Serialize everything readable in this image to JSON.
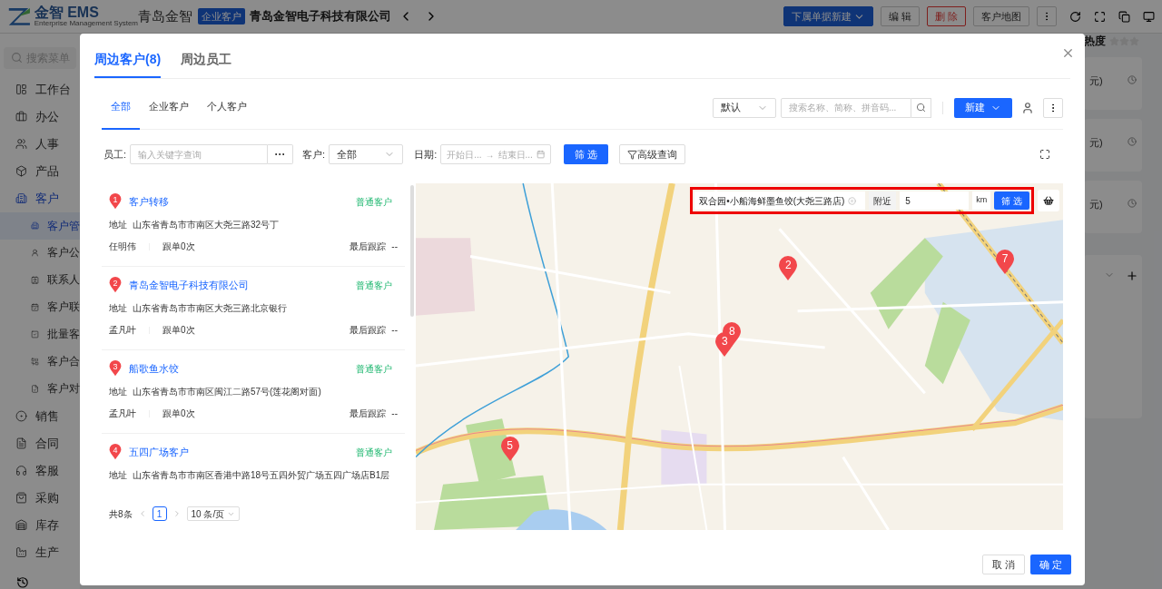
{
  "app": {
    "logo_text": "金智 EMS",
    "logo_subtitle": "Enterprise Management System",
    "company_cut": "青岛金智",
    "badge": "企业客户",
    "title": "青岛金智电子科技有限公司",
    "actions": [
      {
        "label": "下属单据新建",
        "kind": "primary"
      },
      {
        "label": "编 辑",
        "kind": "default"
      },
      {
        "label": "删 除",
        "kind": "danger"
      },
      {
        "label": "客户地图",
        "kind": "default"
      }
    ]
  },
  "sidebar": {
    "search_placeholder": "搜索菜单",
    "items": [
      {
        "label": "工作台",
        "selected": false
      },
      {
        "label": "办公",
        "selected": false
      },
      {
        "label": "人事",
        "selected": false
      },
      {
        "label": "产品",
        "selected": false
      },
      {
        "label": "客户",
        "selected": true,
        "children": [
          {
            "label": "客户管",
            "selected": true
          },
          {
            "label": "客户公",
            "selected": false
          },
          {
            "label": "联系人",
            "selected": false
          },
          {
            "label": "客户联",
            "selected": false
          },
          {
            "label": "批量客",
            "selected": false
          },
          {
            "label": "客户合",
            "selected": false
          },
          {
            "label": "客户对",
            "selected": false
          }
        ]
      },
      {
        "label": "销售",
        "selected": false
      },
      {
        "label": "合同",
        "selected": false
      },
      {
        "label": "客服",
        "selected": false
      },
      {
        "label": "采购",
        "selected": false
      },
      {
        "label": "库存",
        "selected": false
      },
      {
        "label": "生产",
        "selected": false
      }
    ]
  },
  "right_panel": {
    "heading": "热度",
    "amounts": [
      "元)",
      "元)",
      "元)"
    ]
  },
  "modal": {
    "tabs": [
      {
        "label": "周边客户(8)",
        "selected": true
      },
      {
        "label": "周边员工",
        "selected": false
      }
    ],
    "sub_tabs": [
      {
        "label": "全部",
        "selected": true
      },
      {
        "label": "企业客户",
        "selected": false
      },
      {
        "label": "个人客户",
        "selected": false
      }
    ],
    "sort_value": "默认",
    "search_placeholder": "搜索名称、简称、拼音码...",
    "new_button": "新建",
    "filters": {
      "employee_label": "员工:",
      "employee_placeholder": "输入关键字查询",
      "more": "···",
      "customer_label": "客户:",
      "customer_value": "全部",
      "date_label": "日期:",
      "date_start": "开始日...",
      "date_arrow": "→",
      "date_end": "结束日...",
      "filter_button": "筛 选",
      "advanced_button": "高级查询"
    },
    "customers": [
      {
        "index": "1",
        "name": "客户转移",
        "type": "普通客户",
        "address_label": "地址",
        "address": "山东省青岛市市南区大尧三路32号丁",
        "owner": "任明伟",
        "follow_count": "跟单0次",
        "last_label": "最后跟踪",
        "last_value": "--"
      },
      {
        "index": "2",
        "name": "青岛金智电子科技有限公司",
        "type": "普通客户",
        "address_label": "地址",
        "address": "山东省青岛市市南区大尧三路北京银行",
        "owner": "孟凡叶",
        "follow_count": "跟单0次",
        "last_label": "最后跟踪",
        "last_value": "--"
      },
      {
        "index": "3",
        "name": "船歌鱼水饺",
        "type": "普通客户",
        "address_label": "地址",
        "address": "山东省青岛市市南区闽江二路57号(莲花阁对面)",
        "owner": "孟凡叶",
        "follow_count": "跟单0次",
        "last_label": "最后跟踪",
        "last_value": "--"
      },
      {
        "index": "4",
        "name": "五四广场客户",
        "type": "普通客户",
        "address_label": "地址",
        "address": "山东省青岛市市南区香港中路18号五四外贸广场五四广场店B1层"
      }
    ],
    "pagination": {
      "total": "共8条",
      "pages": [
        {
          "label": "1",
          "selected": true
        }
      ],
      "page_size": "10 条/页"
    },
    "map": {
      "place": "双合园•小船海鲜墨鱼饺(大尧三路店)",
      "nearby_label": "附近",
      "radius": "5",
      "unit": "km",
      "filter_button": "筛 选",
      "markers": [
        {
          "label": "2"
        },
        {
          "label": "8"
        },
        {
          "label": "3"
        },
        {
          "label": "5"
        },
        {
          "label": "7"
        }
      ]
    },
    "footer": {
      "cancel": "取 消",
      "ok": "确 定"
    }
  }
}
